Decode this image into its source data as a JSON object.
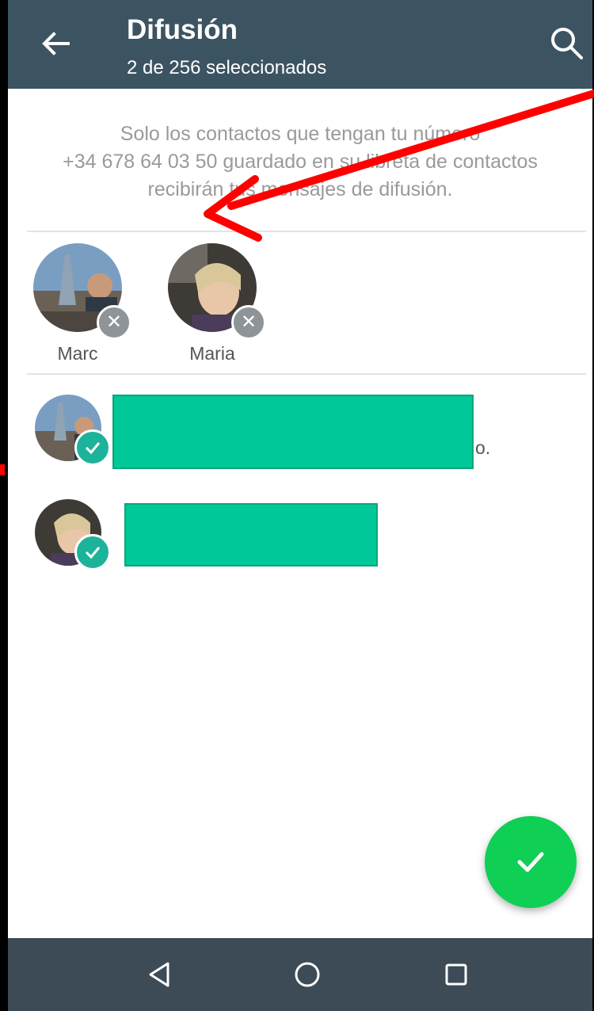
{
  "header": {
    "title": "Difusión",
    "subtitle": "2 de 256 seleccionados"
  },
  "notice": {
    "line1": "Solo los contactos que tengan tu número",
    "line2": "+34 678 64 03 50 guardado en su libreta de contactos",
    "line3": "recibirán tus mensajes de difusión."
  },
  "selected": [
    {
      "name": "Marc"
    },
    {
      "name": "Maria"
    }
  ],
  "contacts": [
    {
      "info": "o."
    },
    {
      "info": ""
    }
  ],
  "colors": {
    "appbar": "#3c5462",
    "accent": "#1db39a",
    "fab": "#0fcf55",
    "redaction": "#00c896",
    "annotation_arrow": "#ff0000"
  },
  "icons": [
    "back-arrow-icon",
    "search-icon",
    "remove-icon",
    "check-icon",
    "nav-back-icon",
    "nav-home-icon",
    "nav-recents-icon"
  ]
}
